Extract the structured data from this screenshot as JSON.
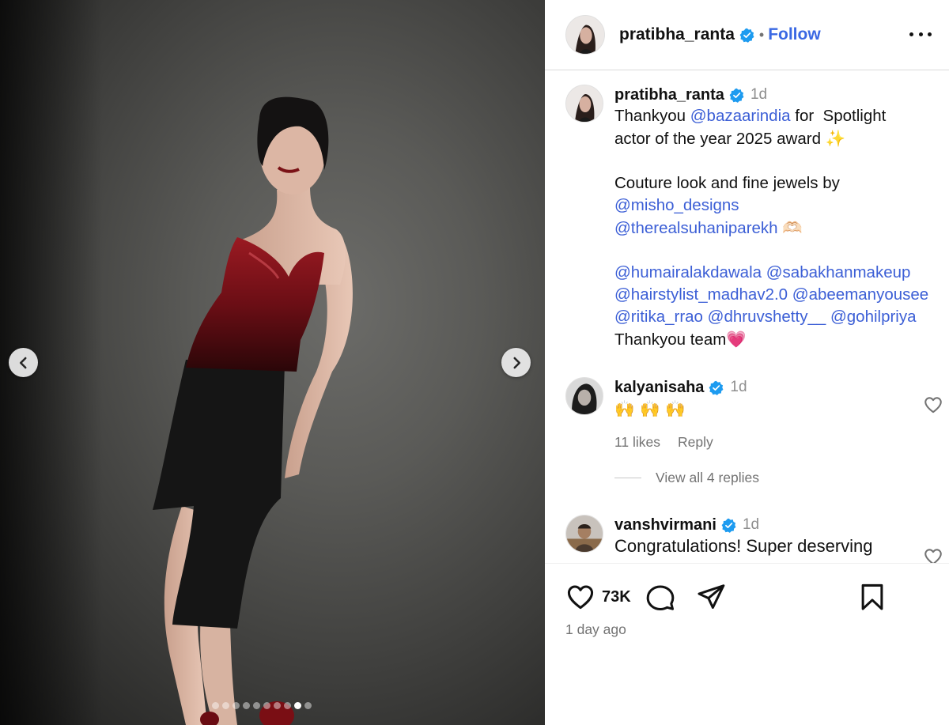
{
  "media": {
    "carousel_dots": 10,
    "active_dot": 8
  },
  "header": {
    "username": "pratibha_ranta",
    "separator": "•",
    "follow_label": "Follow"
  },
  "caption": {
    "username": "pratibha_ranta",
    "time": "1d",
    "lines": [
      {
        "segments": [
          {
            "t": "Thankyou "
          },
          {
            "t": "@bazaarindia",
            "m": true
          },
          {
            "t": " for  Spotlight"
          }
        ]
      },
      {
        "segments": [
          {
            "t": "actor of the year 2025 award "
          },
          {
            "t": "✨",
            "e": true
          }
        ]
      },
      {
        "segments": [
          {
            "t": " "
          }
        ]
      },
      {
        "segments": [
          {
            "t": "Couture look and fine jewels by"
          }
        ]
      },
      {
        "segments": [
          {
            "t": "@misho_designs",
            "m": true
          }
        ]
      },
      {
        "segments": [
          {
            "t": "@therealsuhaniparekh",
            "m": true
          },
          {
            "t": " "
          },
          {
            "t": "🫶🏻",
            "e": true
          }
        ]
      },
      {
        "segments": [
          {
            "t": " "
          }
        ]
      },
      {
        "segments": [
          {
            "t": "@humairalakdawala",
            "m": true
          },
          {
            "t": " "
          },
          {
            "t": "@sabakhanmakeup",
            "m": true
          }
        ]
      },
      {
        "segments": [
          {
            "t": "@hairstylist_madhav2.0",
            "m": true
          },
          {
            "t": " "
          },
          {
            "t": "@abeemanyousee",
            "m": true
          }
        ]
      },
      {
        "segments": [
          {
            "t": "@ritika_rrao",
            "m": true
          },
          {
            "t": " "
          },
          {
            "t": "@dhruvshetty__",
            "m": true
          },
          {
            "t": " "
          },
          {
            "t": "@gohilpriya",
            "m": true
          }
        ]
      },
      {
        "segments": [
          {
            "t": "Thankyou team"
          },
          {
            "t": "💗",
            "e": true
          }
        ]
      }
    ]
  },
  "comments": [
    {
      "username": "kalyanisaha",
      "time": "1d",
      "text": "🙌 🙌 🙌",
      "likes": "11 likes",
      "reply_label": "Reply",
      "view_replies": "View all 4 replies"
    },
    {
      "username": "vanshvirmani",
      "time": "1d",
      "text": "Congratulations! Super deserving"
    }
  ],
  "actions": {
    "likes_count": "73K",
    "posted": "1 day ago"
  },
  "colors": {
    "link": "#3c5fd6",
    "follow": "#3a68e3",
    "verified": "#1d9bf0",
    "muted": "#737373"
  },
  "icons": [
    "chevron-left-icon",
    "chevron-right-icon",
    "verified-badge-icon",
    "more-icon",
    "heart-icon",
    "comment-icon",
    "share-icon",
    "bookmark-icon"
  ]
}
